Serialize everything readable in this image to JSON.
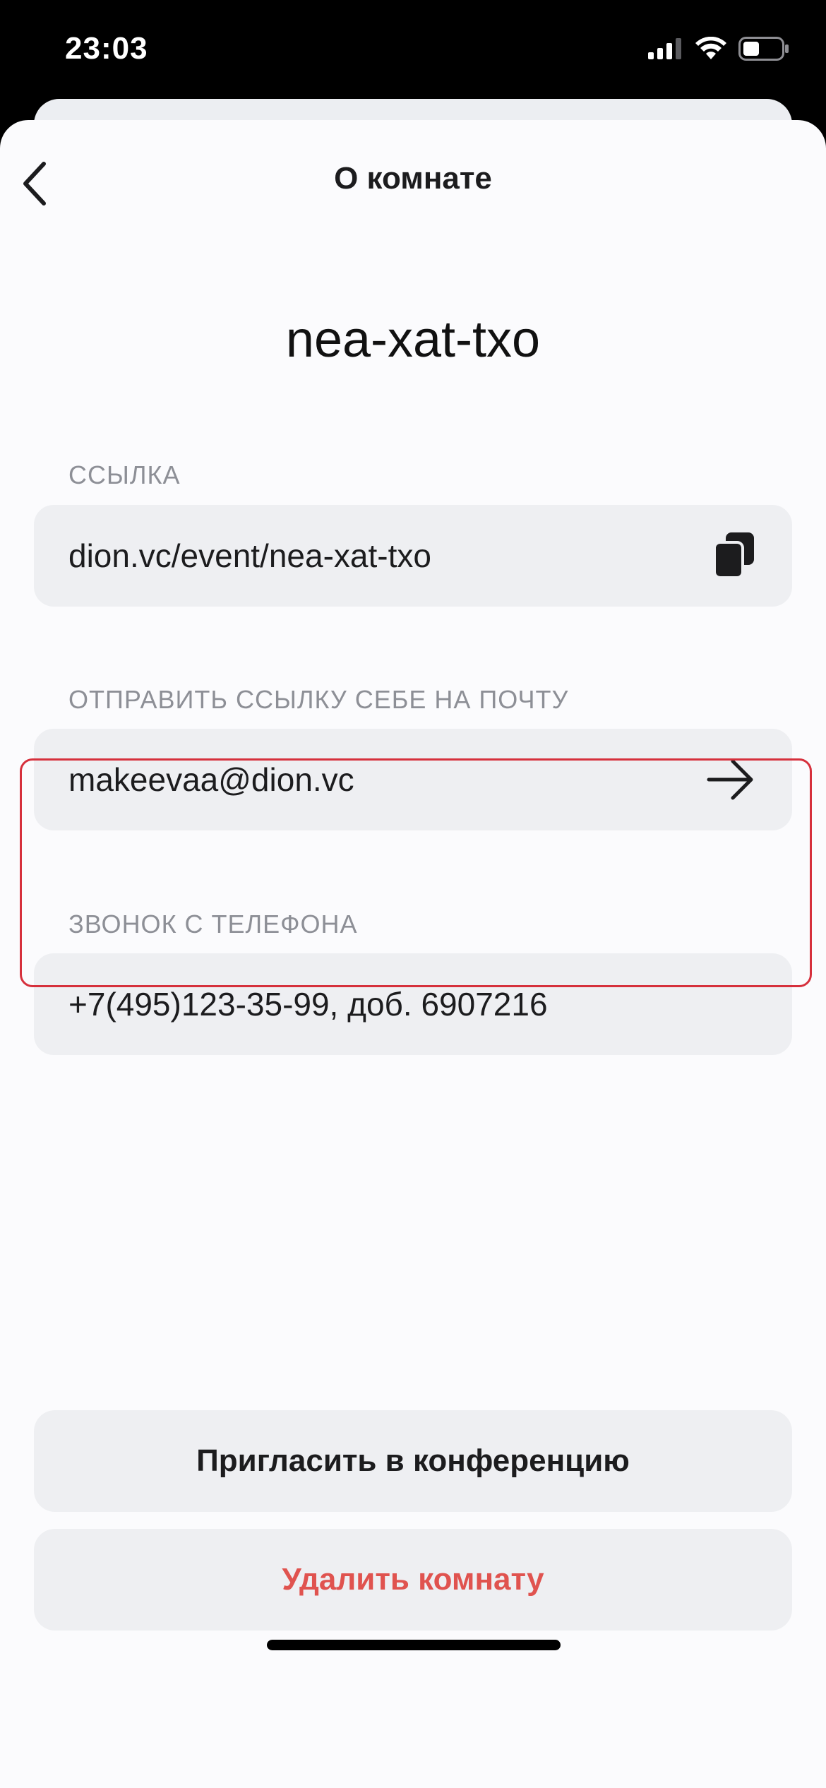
{
  "status_bar": {
    "time": "23:03"
  },
  "header": {
    "title": "О комнате"
  },
  "room": {
    "name": "nea-xat-txo"
  },
  "link": {
    "label": "ССЫЛКА",
    "value": "dion.vc/event/nea-xat-txo",
    "icon": "copy-icon"
  },
  "email": {
    "label": "ОТПРАВИТЬ ССЫЛКУ СЕБЕ НА ПОЧТУ",
    "value": "makeevaa@dion.vc",
    "icon": "arrow-right-icon"
  },
  "phone": {
    "label": "ЗВОНОК С ТЕЛЕФОНА",
    "value": "+7(495)123-35-99, доб. 6907216"
  },
  "actions": {
    "invite_label": "Пригласить в конференцию",
    "delete_label": "Удалить комнату"
  },
  "colors": {
    "delete": "#e0534f",
    "highlight": "#d6303c",
    "field_bg": "#eeeff2",
    "label": "#8d8f96"
  }
}
